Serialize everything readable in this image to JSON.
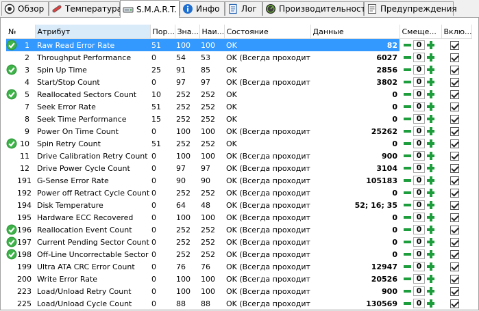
{
  "tabs": [
    {
      "label": "Обзор",
      "icon": "overview-icon",
      "active": false
    },
    {
      "label": "Температура",
      "icon": "thermometer-icon",
      "active": false
    },
    {
      "label": "S.M.A.R.T.",
      "icon": "drive-icon",
      "active": true
    },
    {
      "label": "Инфо",
      "icon": "info-icon",
      "active": false
    },
    {
      "label": "Лог",
      "icon": "log-icon",
      "active": false
    },
    {
      "label": "Производительность",
      "icon": "performance-icon",
      "active": false
    },
    {
      "label": "Предупреждения",
      "icon": "warnings-icon",
      "active": false
    }
  ],
  "columns": {
    "num": "№",
    "attr": "Атрибут",
    "threshold": "Пор...",
    "value": "Зна...",
    "worst": "Наи...",
    "state": "Состояние",
    "data": "Данные",
    "offset": "Смеще...",
    "enabled": "Вклю..."
  },
  "colors": {
    "selection": "#3399ff",
    "stepper_green": "#1e9d3c",
    "sorted_header": "#d9ebf9"
  },
  "rows": [
    {
      "ok": true,
      "id": "1",
      "name": "Raw Read Error Rate",
      "threshold": "51",
      "value": "100",
      "worst": "100",
      "state": "OK",
      "data": "82",
      "offset": "0",
      "selected": true
    },
    {
      "ok": false,
      "id": "2",
      "name": "Throughput Performance",
      "threshold": "0",
      "value": "54",
      "worst": "53",
      "state": "OK (Всегда проходит)",
      "data": "6027",
      "offset": "0"
    },
    {
      "ok": true,
      "id": "3",
      "name": "Spin Up Time",
      "threshold": "25",
      "value": "91",
      "worst": "85",
      "state": "OK",
      "data": "2856",
      "offset": "0"
    },
    {
      "ok": false,
      "id": "4",
      "name": "Start/Stop Count",
      "threshold": "0",
      "value": "97",
      "worst": "97",
      "state": "OK (Всегда проходит)",
      "data": "3802",
      "offset": "0"
    },
    {
      "ok": true,
      "id": "5",
      "name": "Reallocated Sectors Count",
      "threshold": "10",
      "value": "252",
      "worst": "252",
      "state": "OK",
      "data": "0",
      "offset": "0"
    },
    {
      "ok": false,
      "id": "7",
      "name": "Seek Error Rate",
      "threshold": "51",
      "value": "252",
      "worst": "252",
      "state": "OK",
      "data": "0",
      "offset": "0"
    },
    {
      "ok": false,
      "id": "8",
      "name": "Seek Time Performance",
      "threshold": "15",
      "value": "252",
      "worst": "252",
      "state": "OK",
      "data": "0",
      "offset": "0"
    },
    {
      "ok": false,
      "id": "9",
      "name": "Power On Time Count",
      "threshold": "0",
      "value": "100",
      "worst": "100",
      "state": "OK (Всегда проходит)",
      "data": "25262",
      "offset": "0"
    },
    {
      "ok": true,
      "id": "10",
      "name": "Spin Retry Count",
      "threshold": "51",
      "value": "252",
      "worst": "252",
      "state": "OK",
      "data": "0",
      "offset": "0"
    },
    {
      "ok": false,
      "id": "11",
      "name": "Drive Calibration Retry Count",
      "threshold": "0",
      "value": "100",
      "worst": "100",
      "state": "OK (Всегда проходит)",
      "data": "900",
      "offset": "0"
    },
    {
      "ok": false,
      "id": "12",
      "name": "Drive Power Cycle Count",
      "threshold": "0",
      "value": "97",
      "worst": "97",
      "state": "OK (Всегда проходит)",
      "data": "3104",
      "offset": "0"
    },
    {
      "ok": false,
      "id": "191",
      "name": "G-Sense Error Rate",
      "threshold": "0",
      "value": "90",
      "worst": "90",
      "state": "OK (Всегда проходит)",
      "data": "105183",
      "offset": "0"
    },
    {
      "ok": false,
      "id": "192",
      "name": "Power off Retract Cycle Count",
      "threshold": "0",
      "value": "252",
      "worst": "252",
      "state": "OK (Всегда проходит)",
      "data": "0",
      "offset": "0"
    },
    {
      "ok": false,
      "id": "194",
      "name": "Disk Temperature",
      "threshold": "0",
      "value": "64",
      "worst": "48",
      "state": "OK (Всегда проходит)",
      "data": "52; 16; 35",
      "offset": "0"
    },
    {
      "ok": false,
      "id": "195",
      "name": "Hardware ECC Recovered",
      "threshold": "0",
      "value": "100",
      "worst": "100",
      "state": "OK (Всегда проходит)",
      "data": "0",
      "offset": "0"
    },
    {
      "ok": true,
      "id": "196",
      "name": "Reallocation Event Count",
      "threshold": "0",
      "value": "252",
      "worst": "252",
      "state": "OK (Всегда проходит)",
      "data": "0",
      "offset": "0"
    },
    {
      "ok": true,
      "id": "197",
      "name": "Current Pending Sector Count",
      "threshold": "0",
      "value": "252",
      "worst": "252",
      "state": "OK (Всегда проходит)",
      "data": "0",
      "offset": "0"
    },
    {
      "ok": true,
      "id": "198",
      "name": "Off-Line Uncorrectable Sector ...",
      "threshold": "0",
      "value": "252",
      "worst": "252",
      "state": "OK (Всегда проходит)",
      "data": "0",
      "offset": "0"
    },
    {
      "ok": false,
      "id": "199",
      "name": "Ultra ATA CRC Error Count",
      "threshold": "0",
      "value": "76",
      "worst": "76",
      "state": "OK (Всегда проходит)",
      "data": "12947",
      "offset": "0"
    },
    {
      "ok": false,
      "id": "200",
      "name": "Write Error Rate",
      "threshold": "0",
      "value": "100",
      "worst": "100",
      "state": "OK (Всегда проходит)",
      "data": "20526",
      "offset": "0"
    },
    {
      "ok": false,
      "id": "223",
      "name": "Load/Unload Retry Count",
      "threshold": "0",
      "value": "100",
      "worst": "100",
      "state": "OK (Всегда проходит)",
      "data": "900",
      "offset": "0"
    },
    {
      "ok": false,
      "id": "225",
      "name": "Load/Unload Cycle Count",
      "threshold": "0",
      "value": "88",
      "worst": "88",
      "state": "OK (Всегда проходит)",
      "data": "130569",
      "offset": "0"
    }
  ]
}
